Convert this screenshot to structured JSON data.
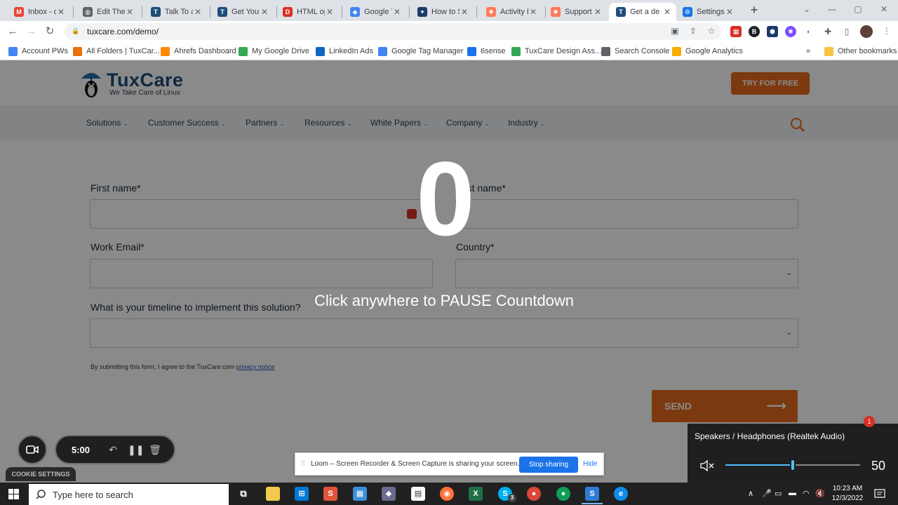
{
  "browser": {
    "tabs": [
      {
        "label": "Inbox - d",
        "icon": "gmail-icon",
        "color": "#ea4335"
      },
      {
        "label": "Edit Them",
        "icon": "globe-icon",
        "color": "#5f6368"
      },
      {
        "label": "Talk To an",
        "icon": "tuxcare-icon",
        "color": "#1f4c78"
      },
      {
        "label": "Get Your",
        "icon": "tuxcare-icon",
        "color": "#1f4c78"
      },
      {
        "label": "HTML op",
        "icon": "d-icon",
        "color": "#d93025"
      },
      {
        "label": "Google T",
        "icon": "tag-manager-icon",
        "color": "#4285f4"
      },
      {
        "label": "How to S",
        "icon": "wrench-icon",
        "color": "#1a3a6b"
      },
      {
        "label": "Activity F",
        "icon": "hubspot-icon",
        "color": "#ff7a59"
      },
      {
        "label": "Support",
        "icon": "hubspot-icon",
        "color": "#ff7a59"
      },
      {
        "label": "Get a de",
        "icon": "tuxcare-icon",
        "color": "#1f4c78"
      },
      {
        "label": "Settings",
        "icon": "gear-icon",
        "color": "#1a73e8"
      }
    ],
    "url": "tuxcare.com/demo/",
    "bookmarks": [
      {
        "label": "Account PWs",
        "color": "#4285f4"
      },
      {
        "label": "All Folders | TuxCar...",
        "color": "#e8710a"
      },
      {
        "label": "Ahrefs Dashboard",
        "color": "#ff8800"
      },
      {
        "label": "My Google Drive",
        "color": "#34a853"
      },
      {
        "label": "LinkedIn Ads",
        "color": "#0a66c2"
      },
      {
        "label": "Google Tag Manager",
        "color": "#4285f4"
      },
      {
        "label": "6sense",
        "color": "#1a73e8"
      },
      {
        "label": "TuxCare Design Ass...",
        "color": "#34a853"
      },
      {
        "label": "Search Console",
        "color": "#5f6368"
      },
      {
        "label": "Google Analytics",
        "color": "#f9ab00"
      }
    ],
    "bookmarks_more": "»",
    "other_bookmarks": "Other bookmarks"
  },
  "site": {
    "logo_name": "TuxCare",
    "logo_tagline": "We Take Care of Linux",
    "try_button": "TRY FOR FREE",
    "nav": [
      "Solutions",
      "Customer Success",
      "Partners",
      "Resources",
      "White Papers",
      "Company",
      "Industry"
    ],
    "form": {
      "first_name_label": "First name*",
      "last_name_label": "Last name*",
      "work_email_label": "Work Email*",
      "country_label": "Country*",
      "timeline_label": "What is your timeline to implement this solution?",
      "consent_text": "By submitting this form, I agree to the TuxCare.com",
      "privacy_link": "privacy notice",
      "send_button": "SEND",
      "send_arrow": "⟶"
    },
    "brand_color": "#e66a1f"
  },
  "loom": {
    "countdown": "0",
    "pause_hint": "Click anywhere to PAUSE Countdown",
    "timer": "5:00",
    "cookie_settings": "COOKIE SETTINGS",
    "share_message": "Loom – Screen Recorder & Screen Capture is sharing your screen.",
    "stop_sharing": "Stop sharing",
    "hide": "Hide"
  },
  "volume": {
    "device": "Speakers / Headphones (Realtek Audio)",
    "level": 50,
    "value_text": "50",
    "accent": "#4cc2ff"
  },
  "chat_badge": "1",
  "taskbar": {
    "search_placeholder": "Type here to search",
    "time": "10:23 AM",
    "date": "12/3/2022",
    "skype_badge": "3"
  }
}
